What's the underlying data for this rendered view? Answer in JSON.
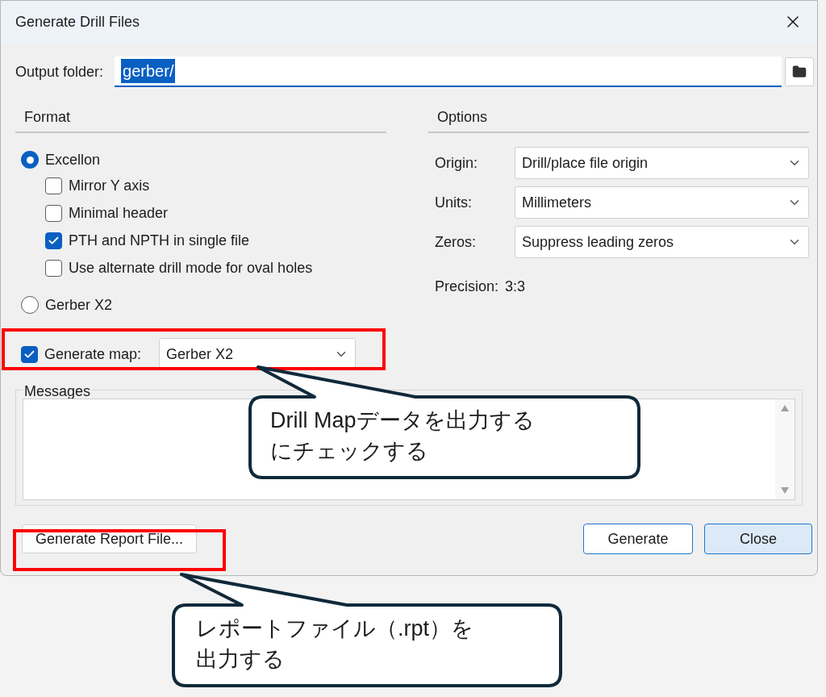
{
  "window": {
    "title": "Generate Drill Files"
  },
  "output_folder": {
    "label": "Output folder:",
    "value": "gerber/"
  },
  "format": {
    "title": "Format",
    "radios": [
      {
        "label": "Excellon",
        "selected": true,
        "options": [
          {
            "label": "Mirror Y axis",
            "checked": false
          },
          {
            "label": "Minimal header",
            "checked": false
          },
          {
            "label": "PTH and NPTH in single file",
            "checked": true
          },
          {
            "label": "Use alternate drill mode for oval holes",
            "checked": false
          }
        ]
      },
      {
        "label": "Gerber X2",
        "selected": false
      }
    ]
  },
  "generate_map": {
    "label": "Generate map:",
    "checked": true,
    "value": "Gerber X2"
  },
  "options": {
    "title": "Options",
    "fields": [
      {
        "label": "Origin:",
        "value": "Drill/place file origin"
      },
      {
        "label": "Units:",
        "value": "Millimeters"
      },
      {
        "label": "Zeros:",
        "value": "Suppress leading zeros"
      }
    ],
    "precision": {
      "label": "Precision:",
      "value": "3:3"
    }
  },
  "messages": {
    "title": "Messages"
  },
  "buttons": {
    "report": "Generate Report File...",
    "generate": "Generate",
    "close": "Close"
  },
  "annotations": [
    {
      "lines": [
        "Drill Mapデータを出力する",
        "にチェックする"
      ]
    },
    {
      "lines": [
        "レポートファイル（.rpt）を",
        "出力する"
      ]
    }
  ]
}
